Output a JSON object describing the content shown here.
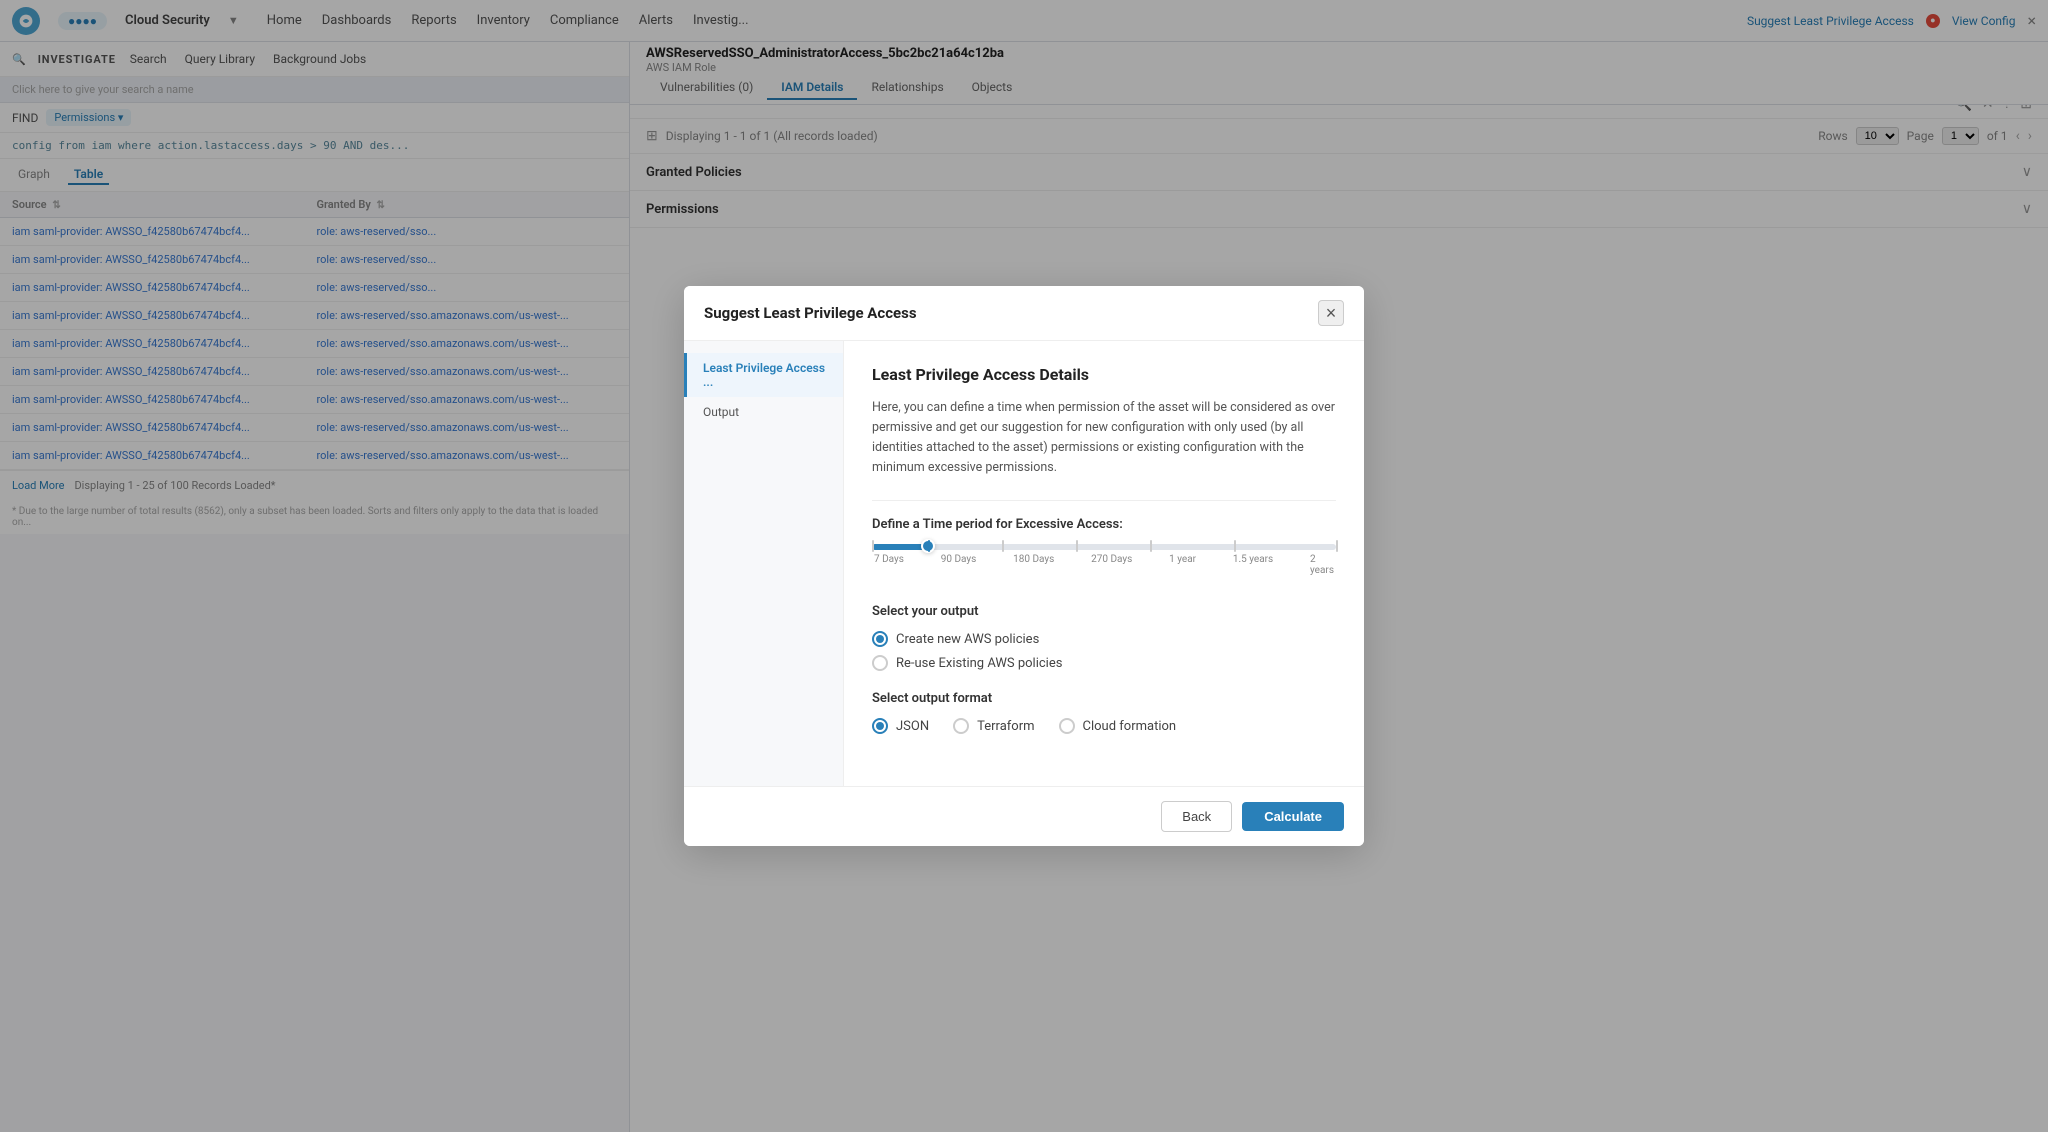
{
  "topnav": {
    "brand_chip": "●●●●",
    "title": "Cloud Security",
    "dropdown_icon": "▼",
    "links": [
      "Home",
      "Dashboards",
      "Reports",
      "Inventory",
      "Compliance",
      "Alerts",
      "Investig..."
    ],
    "suggest_link": "Suggest Least Privilege Access",
    "suggest_dot": "●",
    "view_config": "View Config",
    "close": "×"
  },
  "resource_bar": {
    "title": "AWSReservedSSO_AdministratorAccess_5bc2bc21a64c12ba",
    "subtitle": "AWS IAM Role",
    "tabs": [
      "Vulnerabilities (0)",
      "IAM Details",
      "Relationships",
      "Objects"
    ],
    "active_tab": "IAM Details"
  },
  "left_panel": {
    "investigate_label": "INVESTIGATE",
    "search_link": "Search",
    "query_library_link": "Query Library",
    "background_jobs_link": "Background Jobs",
    "query_hint": "Click here to give your search a name",
    "find_label": "FIND",
    "permissions_chip": "Permissions ▾",
    "query_text": "config from iam where action.lastaccess.days > 90 AND des...",
    "tabs": [
      "Graph",
      "Table"
    ],
    "active_tab": "Table",
    "columns": [
      "Source",
      "Granted By"
    ],
    "rows": [
      {
        "source": "iam saml-provider: AWSSO_f42580b67474bcf4...",
        "granted_by": "role: aws-reserved/sso..."
      },
      {
        "source": "iam saml-provider: AWSSO_f42580b67474bcf4...",
        "granted_by": "role: aws-reserved/sso..."
      },
      {
        "source": "iam saml-provider: AWSSO_f42580b67474bcf4...",
        "granted_by": "role: aws-reserved/sso..."
      },
      {
        "source": "iam saml-provider: AWSSO_f42580b67474bcf4...",
        "granted_by": "role: aws-reserved/sso.amazonaws.com/us-west-..."
      },
      {
        "source": "iam saml-provider: AWSSO_f42580b67474bcf4...",
        "granted_by": "role: aws-reserved/sso.amazonaws.com/us-west-..."
      },
      {
        "source": "iam saml-provider: AWSSO_f42580b67474bcf4...",
        "granted_by": "role: aws-reserved/sso.amazonaws.com/us-west-..."
      },
      {
        "source": "iam saml-provider: AWSSO_f42580b67474bcf4...",
        "granted_by": "role: aws-reserved/sso.amazonaws.com/us-west-..."
      },
      {
        "source": "iam saml-provider: AWSSO_f42580b67474bcf4...",
        "granted_by": "role: aws-reserved/sso.amazonaws.com/us-west-..."
      },
      {
        "source": "iam saml-provider: AWSSO_f42580b67474bcf4...",
        "granted_by": "role: aws-reserved/sso.amazonaws.com/us-west-..."
      }
    ],
    "footer_text": "Displaying 1 - 25 of 100 Records Loaded*",
    "load_more": "Load More",
    "footer_note": "* Due to the large number of total results (8562), only a subset has been loaded. Sorts and filters only apply to the data that is loaded on..."
  },
  "right_panel": {
    "display_text": "Displaying 1 - 1 of 1 (All records loaded)",
    "rows_label": "Rows",
    "rows_value": "10",
    "page_label": "Page",
    "page_value": "1",
    "of_label": "of 1",
    "granted_policies_label": "Granted Policies",
    "permissions_label": "Permissions"
  },
  "modal": {
    "header_title": "Suggest Least Privilege Access",
    "close_label": "×",
    "sidebar_items": [
      {
        "label": "Least Privilege Access ...",
        "active": true
      },
      {
        "label": "Output",
        "active": false
      }
    ],
    "section_title": "Least Privilege Access Details",
    "description": "Here, you can define a time when permission of the asset will be considered as over permissive and get our suggestion for new configuration with only used (by all identities attached to the asset) permissions or existing configuration with the minimum excessive permissions.",
    "time_period_label": "Define a Time period for Excessive Access:",
    "slider_labels": [
      "7 Days",
      "90 Days",
      "180 Days",
      "270 Days",
      "1 year",
      "1.5 years",
      "2\nyears"
    ],
    "slider_value_pct": 12,
    "slider_thumb_pct": 12,
    "output_section_label": "Select your output",
    "output_options": [
      {
        "label": "Create new AWS policies",
        "checked": true
      },
      {
        "label": "Re-use Existing AWS policies",
        "checked": false
      }
    ],
    "format_section_label": "Select output format",
    "format_options": [
      {
        "label": "JSON",
        "checked": true
      },
      {
        "label": "Terraform",
        "checked": false
      },
      {
        "label": "Cloud formation",
        "checked": false
      }
    ],
    "back_btn": "Back",
    "calculate_btn": "Calculate"
  }
}
